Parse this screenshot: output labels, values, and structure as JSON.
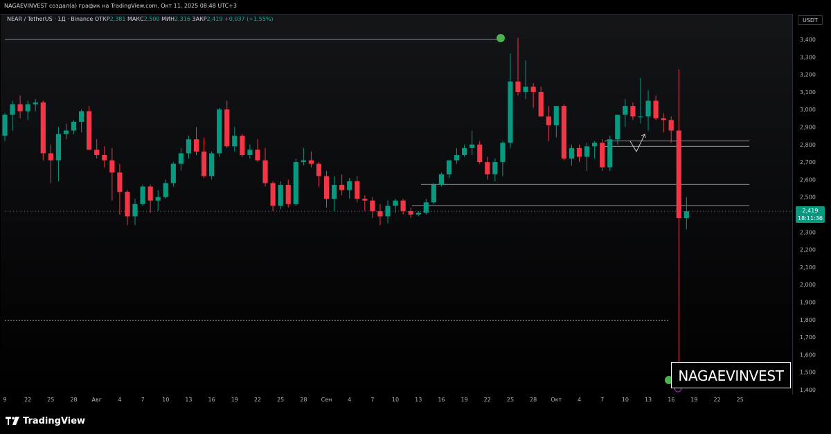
{
  "header": {
    "author_line": "NAGAEVINVEST создал(а) график на TradingView.com, Окт 11, 2025 08:48 UTC+3"
  },
  "legend": {
    "symbol": "NEAR / TetherUS · 1Д · Binance",
    "open_label": "ОТКР",
    "open": "2,381",
    "high_label": "МАКС",
    "high": "2,500",
    "low_label": "МИН",
    "low": "2,316",
    "close_label": "ЗАКР",
    "close": "2,419",
    "change": "+0,037 (+1,55%)"
  },
  "currency": "USDT",
  "last_price": {
    "value": "2,419",
    "countdown": "18:11:36"
  },
  "watermark": "NAGAEVINVEST",
  "footer": {
    "brand": "TradingView"
  },
  "colors": {
    "up": "#089981",
    "down": "#f23645",
    "background": "#000000",
    "level_line": "#b2b5be",
    "marker": "#4caf50"
  },
  "chart_data": {
    "type": "candlestick",
    "ylim": [
      1350,
      3500
    ],
    "y_ticks": [
      1400,
      1500,
      1600,
      1700,
      1800,
      1900,
      2000,
      2100,
      2200,
      2300,
      2400,
      2500,
      2600,
      2700,
      2800,
      2900,
      3000,
      3100,
      3200,
      3300,
      3400
    ],
    "y_tick_labels": [
      "1,400",
      "1,500",
      "1,600",
      "1,700",
      "1,800",
      "1,900",
      "2,000",
      "2,100",
      "2,200",
      "2,300",
      "2,400",
      "2,500",
      "2,600",
      "2,700",
      "2,800",
      "2,900",
      "3,000",
      "3,100",
      "3,200",
      "3,300",
      "3,400"
    ],
    "x_labels": [
      "9",
      "22",
      "25",
      "28",
      "Авг",
      "4",
      "7",
      "10",
      "13",
      "16",
      "19",
      "22",
      "25",
      "28",
      "Сен",
      "4",
      "7",
      "10",
      "13",
      "16",
      "19",
      "22",
      "25",
      "28",
      "Окт",
      "4",
      "7",
      "10",
      "13",
      "16",
      "19",
      "22",
      "25"
    ],
    "candles": [
      [
        2850,
        2980,
        2820,
        2970
      ],
      [
        2970,
        3050,
        2880,
        3030
      ],
      [
        3030,
        3080,
        2950,
        2990
      ],
      [
        2990,
        3050,
        2940,
        3030
      ],
      [
        3030,
        3060,
        2990,
        3040
      ],
      [
        3040,
        3050,
        2710,
        2750
      ],
      [
        2750,
        2800,
        2580,
        2710
      ],
      [
        2710,
        2900,
        2590,
        2860
      ],
      [
        2860,
        2920,
        2830,
        2880
      ],
      [
        2880,
        2940,
        2860,
        2930
      ],
      [
        2930,
        3000,
        2870,
        2990
      ],
      [
        2990,
        3020,
        2770,
        2770
      ],
      [
        2770,
        2830,
        2720,
        2740
      ],
      [
        2740,
        2790,
        2670,
        2710
      ],
      [
        2710,
        2780,
        2480,
        2640
      ],
      [
        2640,
        2690,
        2400,
        2530
      ],
      [
        2530,
        2540,
        2340,
        2390
      ],
      [
        2390,
        2490,
        2340,
        2460
      ],
      [
        2460,
        2570,
        2450,
        2560
      ],
      [
        2560,
        2570,
        2410,
        2480
      ],
      [
        2480,
        2540,
        2420,
        2500
      ],
      [
        2500,
        2600,
        2490,
        2580
      ],
      [
        2580,
        2700,
        2560,
        2690
      ],
      [
        2690,
        2780,
        2650,
        2750
      ],
      [
        2750,
        2850,
        2720,
        2830
      ],
      [
        2830,
        2900,
        2740,
        2760
      ],
      [
        2760,
        2840,
        2610,
        2620
      ],
      [
        2620,
        2760,
        2600,
        2750
      ],
      [
        2750,
        3010,
        2730,
        3000
      ],
      [
        3000,
        3050,
        2780,
        2790
      ],
      [
        2790,
        2900,
        2760,
        2850
      ],
      [
        2850,
        2860,
        2730,
        2740
      ],
      [
        2740,
        2800,
        2720,
        2770
      ],
      [
        2770,
        2830,
        2700,
        2710
      ],
      [
        2710,
        2780,
        2560,
        2580
      ],
      [
        2580,
        2590,
        2420,
        2450
      ],
      [
        2450,
        2590,
        2430,
        2570
      ],
      [
        2570,
        2600,
        2440,
        2460
      ],
      [
        2460,
        2720,
        2450,
        2700
      ],
      [
        2700,
        2780,
        2680,
        2710
      ],
      [
        2710,
        2760,
        2670,
        2690
      ],
      [
        2690,
        2700,
        2560,
        2620
      ],
      [
        2620,
        2650,
        2440,
        2490
      ],
      [
        2490,
        2620,
        2420,
        2570
      ],
      [
        2570,
        2630,
        2510,
        2540
      ],
      [
        2540,
        2610,
        2490,
        2590
      ],
      [
        2590,
        2620,
        2470,
        2490
      ],
      [
        2490,
        2510,
        2420,
        2480
      ],
      [
        2480,
        2500,
        2380,
        2420
      ],
      [
        2420,
        2460,
        2340,
        2390
      ],
      [
        2390,
        2480,
        2350,
        2450
      ],
      [
        2450,
        2490,
        2410,
        2480
      ],
      [
        2480,
        2490,
        2400,
        2420
      ],
      [
        2420,
        2440,
        2380,
        2400
      ],
      [
        2400,
        2420,
        2390,
        2410
      ],
      [
        2410,
        2490,
        2400,
        2470
      ],
      [
        2470,
        2580,
        2460,
        2570
      ],
      [
        2570,
        2640,
        2560,
        2630
      ],
      [
        2630,
        2710,
        2610,
        2710
      ],
      [
        2710,
        2780,
        2690,
        2740
      ],
      [
        2740,
        2800,
        2730,
        2780
      ],
      [
        2780,
        2880,
        2740,
        2800
      ],
      [
        2800,
        2820,
        2690,
        2700
      ],
      [
        2700,
        2730,
        2600,
        2630
      ],
      [
        2630,
        2720,
        2590,
        2700
      ],
      [
        2700,
        2820,
        2620,
        2810
      ],
      [
        2810,
        3320,
        2780,
        3160
      ],
      [
        3160,
        3410,
        3080,
        3100
      ],
      [
        3100,
        3280,
        3060,
        3130
      ],
      [
        3130,
        3150,
        3010,
        3100
      ],
      [
        3100,
        3130,
        2960,
        2960
      ],
      [
        2960,
        3020,
        2820,
        2910
      ],
      [
        2910,
        2940,
        2840,
        3020
      ],
      [
        3020,
        3030,
        2710,
        2720
      ],
      [
        2720,
        2800,
        2680,
        2780
      ],
      [
        2780,
        2800,
        2700,
        2730
      ],
      [
        2730,
        2810,
        2650,
        2790
      ],
      [
        2790,
        2820,
        2720,
        2810
      ],
      [
        2810,
        2830,
        2650,
        2670
      ],
      [
        2670,
        2850,
        2650,
        2830
      ],
      [
        2830,
        2950,
        2800,
        2970
      ],
      [
        2970,
        3060,
        2900,
        3020
      ],
      [
        3020,
        3040,
        2940,
        2960
      ],
      [
        2960,
        3180,
        2920,
        2960
      ],
      [
        2960,
        3110,
        2880,
        3050
      ],
      [
        3050,
        3080,
        2940,
        2950
      ],
      [
        2950,
        2980,
        2870,
        2940
      ],
      [
        2940,
        2960,
        2810,
        2880
      ],
      [
        2880,
        3230,
        1540,
        2380
      ],
      [
        2380,
        2500,
        2316,
        2419
      ]
    ]
  }
}
